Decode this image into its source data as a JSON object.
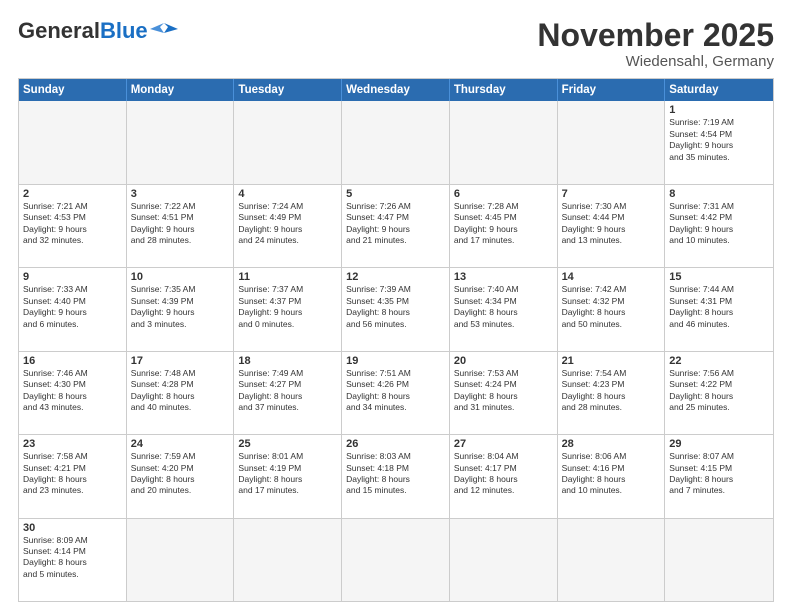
{
  "header": {
    "logo_general": "General",
    "logo_blue": "Blue",
    "month": "November 2025",
    "location": "Wiedensahl, Germany"
  },
  "weekdays": [
    "Sunday",
    "Monday",
    "Tuesday",
    "Wednesday",
    "Thursday",
    "Friday",
    "Saturday"
  ],
  "rows": [
    [
      {
        "date": "",
        "info": ""
      },
      {
        "date": "",
        "info": ""
      },
      {
        "date": "",
        "info": ""
      },
      {
        "date": "",
        "info": ""
      },
      {
        "date": "",
        "info": ""
      },
      {
        "date": "",
        "info": ""
      },
      {
        "date": "1",
        "info": "Sunrise: 7:19 AM\nSunset: 4:54 PM\nDaylight: 9 hours\nand 35 minutes."
      }
    ],
    [
      {
        "date": "2",
        "info": "Sunrise: 7:21 AM\nSunset: 4:53 PM\nDaylight: 9 hours\nand 32 minutes."
      },
      {
        "date": "3",
        "info": "Sunrise: 7:22 AM\nSunset: 4:51 PM\nDaylight: 9 hours\nand 28 minutes."
      },
      {
        "date": "4",
        "info": "Sunrise: 7:24 AM\nSunset: 4:49 PM\nDaylight: 9 hours\nand 24 minutes."
      },
      {
        "date": "5",
        "info": "Sunrise: 7:26 AM\nSunset: 4:47 PM\nDaylight: 9 hours\nand 21 minutes."
      },
      {
        "date": "6",
        "info": "Sunrise: 7:28 AM\nSunset: 4:45 PM\nDaylight: 9 hours\nand 17 minutes."
      },
      {
        "date": "7",
        "info": "Sunrise: 7:30 AM\nSunset: 4:44 PM\nDaylight: 9 hours\nand 13 minutes."
      },
      {
        "date": "8",
        "info": "Sunrise: 7:31 AM\nSunset: 4:42 PM\nDaylight: 9 hours\nand 10 minutes."
      }
    ],
    [
      {
        "date": "9",
        "info": "Sunrise: 7:33 AM\nSunset: 4:40 PM\nDaylight: 9 hours\nand 6 minutes."
      },
      {
        "date": "10",
        "info": "Sunrise: 7:35 AM\nSunset: 4:39 PM\nDaylight: 9 hours\nand 3 minutes."
      },
      {
        "date": "11",
        "info": "Sunrise: 7:37 AM\nSunset: 4:37 PM\nDaylight: 9 hours\nand 0 minutes."
      },
      {
        "date": "12",
        "info": "Sunrise: 7:39 AM\nSunset: 4:35 PM\nDaylight: 8 hours\nand 56 minutes."
      },
      {
        "date": "13",
        "info": "Sunrise: 7:40 AM\nSunset: 4:34 PM\nDaylight: 8 hours\nand 53 minutes."
      },
      {
        "date": "14",
        "info": "Sunrise: 7:42 AM\nSunset: 4:32 PM\nDaylight: 8 hours\nand 50 minutes."
      },
      {
        "date": "15",
        "info": "Sunrise: 7:44 AM\nSunset: 4:31 PM\nDaylight: 8 hours\nand 46 minutes."
      }
    ],
    [
      {
        "date": "16",
        "info": "Sunrise: 7:46 AM\nSunset: 4:30 PM\nDaylight: 8 hours\nand 43 minutes."
      },
      {
        "date": "17",
        "info": "Sunrise: 7:48 AM\nSunset: 4:28 PM\nDaylight: 8 hours\nand 40 minutes."
      },
      {
        "date": "18",
        "info": "Sunrise: 7:49 AM\nSunset: 4:27 PM\nDaylight: 8 hours\nand 37 minutes."
      },
      {
        "date": "19",
        "info": "Sunrise: 7:51 AM\nSunset: 4:26 PM\nDaylight: 8 hours\nand 34 minutes."
      },
      {
        "date": "20",
        "info": "Sunrise: 7:53 AM\nSunset: 4:24 PM\nDaylight: 8 hours\nand 31 minutes."
      },
      {
        "date": "21",
        "info": "Sunrise: 7:54 AM\nSunset: 4:23 PM\nDaylight: 8 hours\nand 28 minutes."
      },
      {
        "date": "22",
        "info": "Sunrise: 7:56 AM\nSunset: 4:22 PM\nDaylight: 8 hours\nand 25 minutes."
      }
    ],
    [
      {
        "date": "23",
        "info": "Sunrise: 7:58 AM\nSunset: 4:21 PM\nDaylight: 8 hours\nand 23 minutes."
      },
      {
        "date": "24",
        "info": "Sunrise: 7:59 AM\nSunset: 4:20 PM\nDaylight: 8 hours\nand 20 minutes."
      },
      {
        "date": "25",
        "info": "Sunrise: 8:01 AM\nSunset: 4:19 PM\nDaylight: 8 hours\nand 17 minutes."
      },
      {
        "date": "26",
        "info": "Sunrise: 8:03 AM\nSunset: 4:18 PM\nDaylight: 8 hours\nand 15 minutes."
      },
      {
        "date": "27",
        "info": "Sunrise: 8:04 AM\nSunset: 4:17 PM\nDaylight: 8 hours\nand 12 minutes."
      },
      {
        "date": "28",
        "info": "Sunrise: 8:06 AM\nSunset: 4:16 PM\nDaylight: 8 hours\nand 10 minutes."
      },
      {
        "date": "29",
        "info": "Sunrise: 8:07 AM\nSunset: 4:15 PM\nDaylight: 8 hours\nand 7 minutes."
      }
    ],
    [
      {
        "date": "30",
        "info": "Sunrise: 8:09 AM\nSunset: 4:14 PM\nDaylight: 8 hours\nand 5 minutes."
      },
      {
        "date": "",
        "info": ""
      },
      {
        "date": "",
        "info": ""
      },
      {
        "date": "",
        "info": ""
      },
      {
        "date": "",
        "info": ""
      },
      {
        "date": "",
        "info": ""
      },
      {
        "date": "",
        "info": ""
      }
    ]
  ]
}
